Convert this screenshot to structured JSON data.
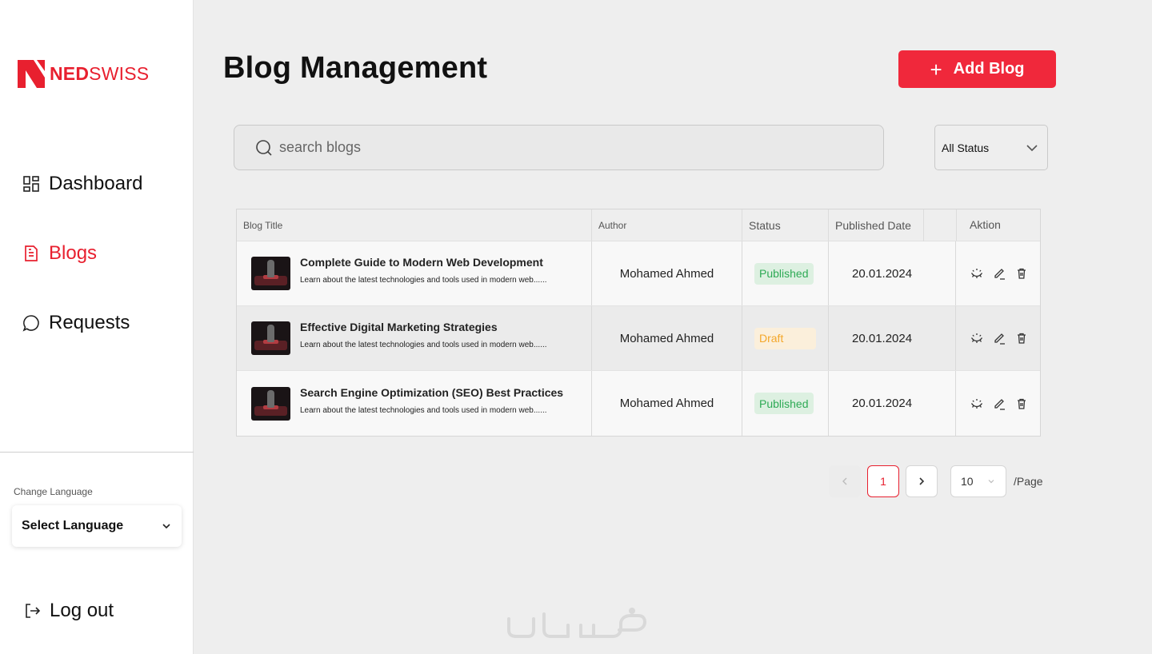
{
  "brand": {
    "name_bold": "NED",
    "name_light": "SWISS",
    "color": "#e8202f"
  },
  "sidebar": {
    "items": [
      {
        "label": "Dashboard",
        "icon": "dashboard-grid-icon",
        "active": false
      },
      {
        "label": "Blogs",
        "icon": "document-icon",
        "active": true
      },
      {
        "label": "Requests",
        "icon": "chat-bubble-icon",
        "active": false
      }
    ],
    "language": {
      "label": "Change Language",
      "value": "Select Language"
    },
    "logout_label": "Log out"
  },
  "header": {
    "title": "Blog Management",
    "add_button": "Add Blog"
  },
  "search": {
    "placeholder": "search blogs"
  },
  "filter": {
    "status_value": "All Status"
  },
  "table": {
    "columns": [
      "Blog Title",
      "Author",
      "Status",
      "Published Date",
      "Aktion"
    ],
    "rows": [
      {
        "title": "Complete Guide to Modern Web Development",
        "description": "Learn about the latest technologies and tools used in modern web......",
        "author": "Mohamed Ahmed",
        "status": "Published",
        "date": "20.01.2024"
      },
      {
        "title": "Effective Digital Marketing Strategies",
        "description": "Learn about the latest technologies and tools used in modern web......",
        "author": "Mohamed Ahmed",
        "status": "Draft",
        "date": "20.01.2024"
      },
      {
        "title": "Search Engine Optimization (SEO) Best Practices",
        "description": "Learn about the latest technologies and tools used in modern web......",
        "author": "Mohamed Ahmed",
        "status": "Published",
        "date": "20.01.2024"
      }
    ]
  },
  "pagination": {
    "current_page": "1",
    "page_size": "10",
    "page_size_suffix": "/Page"
  },
  "colors": {
    "accent": "#f0283b",
    "published": "#2eaa55",
    "draft": "#f4a72a"
  }
}
